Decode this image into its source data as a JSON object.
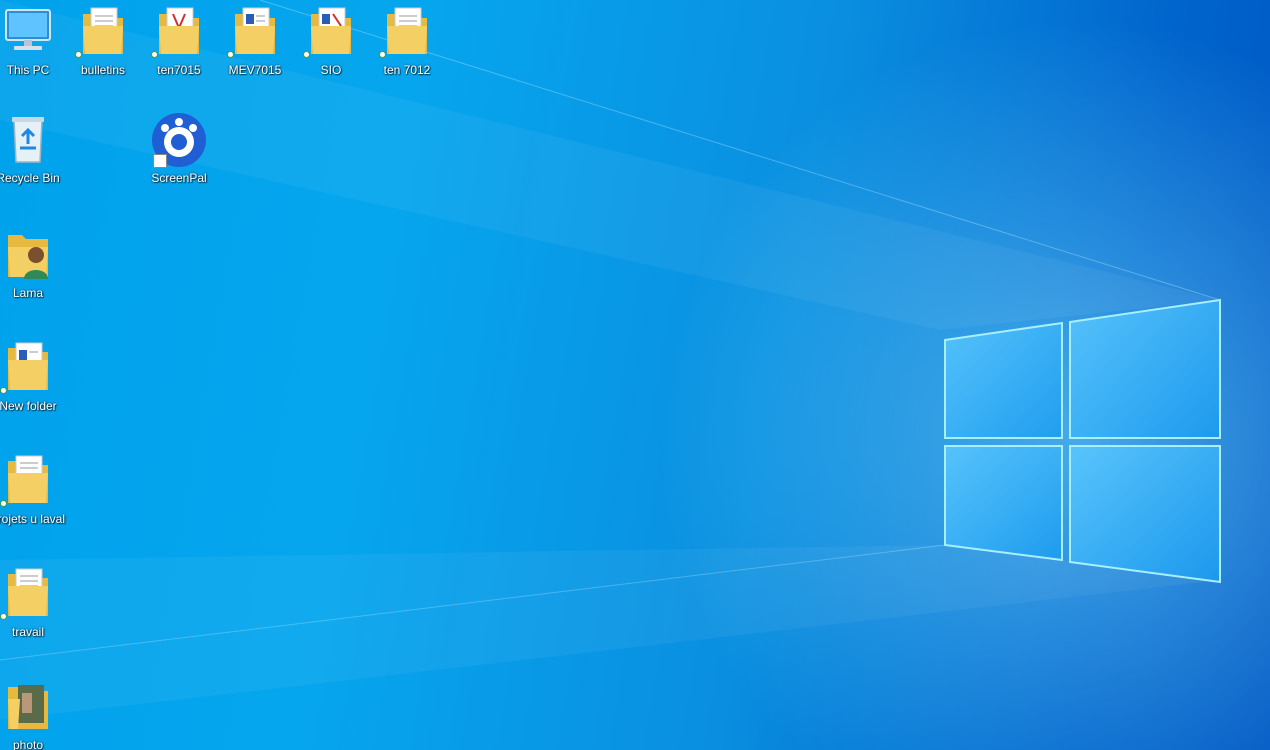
{
  "desktop": {
    "icons": [
      {
        "label": "This PC"
      },
      {
        "label": "bulletins"
      },
      {
        "label": "ten7015"
      },
      {
        "label": "MEV7015"
      },
      {
        "label": "SIO"
      },
      {
        "label": "ten 7012"
      },
      {
        "label": "Recycle Bin"
      },
      {
        "label": "ScreenPal"
      },
      {
        "label": "Lama"
      },
      {
        "label": "New folder"
      },
      {
        "label": "projets u laval"
      },
      {
        "label": "travail"
      },
      {
        "label": "photo"
      }
    ]
  },
  "colors": {
    "wallpaper_light": "#00a2ec",
    "wallpaper_dark": "#0056c2",
    "folder": "#f4cf63",
    "screenpal": "#1f5fd3"
  }
}
